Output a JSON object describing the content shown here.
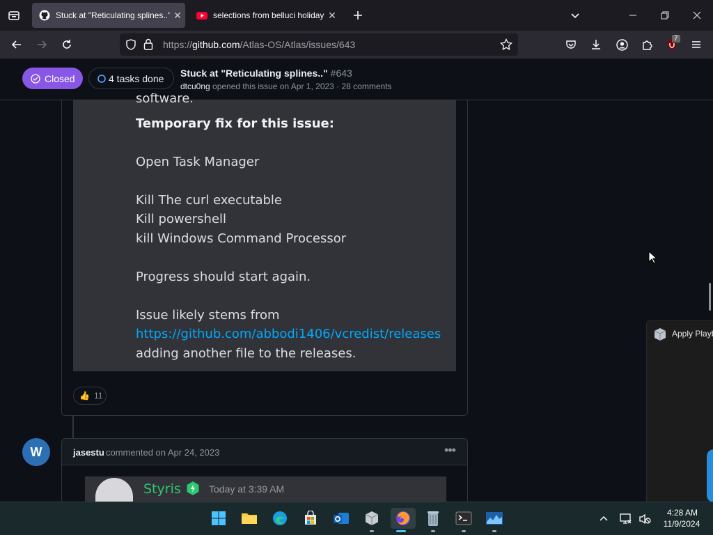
{
  "browser": {
    "tabs": [
      {
        "title": "Stuck at \"Reticulating splines..\" ·",
        "active": true
      },
      {
        "title": "selections from belluci holidays",
        "active": false
      }
    ],
    "url": {
      "prefix": "https://",
      "host": "github.com",
      "path": "/Atlas-OS/Atlas/issues/643"
    },
    "notification_count": "7"
  },
  "issue_header": {
    "state": "Closed",
    "tasks": "4 tasks done",
    "title": "Stuck at \"Reticulating splines..\"",
    "number": "#643",
    "author": "dtcu0ng",
    "meta": " opened this issue on Apr 1, 2023 · 28 comments"
  },
  "quoted_message": {
    "line_software": "software.",
    "heading": "Temporary fix for this issue:",
    "step1": "Open Task Manager",
    "step2": "Kill The curl executable",
    "step3": "Kill powershell",
    "step4": "kill Windows Command Processor",
    "progress": "Progress should start again.",
    "stems": "Issue likely stems from",
    "link": "https://github.com/abbodi1406/vcredist/releases",
    "adding": "adding another file to the releases."
  },
  "reaction": {
    "emoji": "👍",
    "count": "11"
  },
  "comment2": {
    "avatar_letter": "W",
    "author": "jasestu",
    "meta": "commented on Apr 24, 2023",
    "quote_author": "Styris",
    "quote_time": "Today at 3:39 AM"
  },
  "side_panel": {
    "label": "Apply Playb"
  },
  "taskbar": {
    "time": "4:28 AM",
    "date": "11/9/2024"
  },
  "colors": {
    "closed_purple": "#8957e5",
    "discord_bg": "#313338",
    "link_blue": "#00a8fc",
    "discord_green": "#2dc770"
  }
}
